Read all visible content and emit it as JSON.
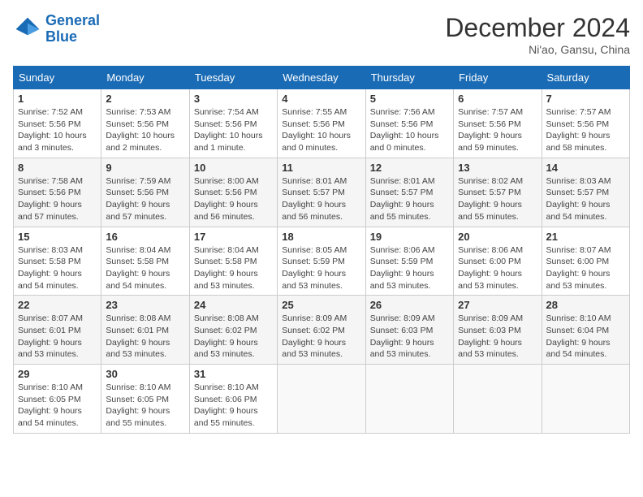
{
  "header": {
    "logo_line1": "General",
    "logo_line2": "Blue",
    "month_title": "December 2024",
    "location": "Ni'ao, Gansu, China"
  },
  "weekdays": [
    "Sunday",
    "Monday",
    "Tuesday",
    "Wednesday",
    "Thursday",
    "Friday",
    "Saturday"
  ],
  "weeks": [
    [
      {
        "day": "1",
        "sunrise": "7:52 AM",
        "sunset": "5:56 PM",
        "daylight": "10 hours and 3 minutes."
      },
      {
        "day": "2",
        "sunrise": "7:53 AM",
        "sunset": "5:56 PM",
        "daylight": "10 hours and 2 minutes."
      },
      {
        "day": "3",
        "sunrise": "7:54 AM",
        "sunset": "5:56 PM",
        "daylight": "10 hours and 1 minute."
      },
      {
        "day": "4",
        "sunrise": "7:55 AM",
        "sunset": "5:56 PM",
        "daylight": "10 hours and 0 minutes."
      },
      {
        "day": "5",
        "sunrise": "7:56 AM",
        "sunset": "5:56 PM",
        "daylight": "10 hours and 0 minutes."
      },
      {
        "day": "6",
        "sunrise": "7:57 AM",
        "sunset": "5:56 PM",
        "daylight": "9 hours and 59 minutes."
      },
      {
        "day": "7",
        "sunrise": "7:57 AM",
        "sunset": "5:56 PM",
        "daylight": "9 hours and 58 minutes."
      }
    ],
    [
      {
        "day": "8",
        "sunrise": "7:58 AM",
        "sunset": "5:56 PM",
        "daylight": "9 hours and 57 minutes."
      },
      {
        "day": "9",
        "sunrise": "7:59 AM",
        "sunset": "5:56 PM",
        "daylight": "9 hours and 57 minutes."
      },
      {
        "day": "10",
        "sunrise": "8:00 AM",
        "sunset": "5:56 PM",
        "daylight": "9 hours and 56 minutes."
      },
      {
        "day": "11",
        "sunrise": "8:01 AM",
        "sunset": "5:57 PM",
        "daylight": "9 hours and 56 minutes."
      },
      {
        "day": "12",
        "sunrise": "8:01 AM",
        "sunset": "5:57 PM",
        "daylight": "9 hours and 55 minutes."
      },
      {
        "day": "13",
        "sunrise": "8:02 AM",
        "sunset": "5:57 PM",
        "daylight": "9 hours and 55 minutes."
      },
      {
        "day": "14",
        "sunrise": "8:03 AM",
        "sunset": "5:57 PM",
        "daylight": "9 hours and 54 minutes."
      }
    ],
    [
      {
        "day": "15",
        "sunrise": "8:03 AM",
        "sunset": "5:58 PM",
        "daylight": "9 hours and 54 minutes."
      },
      {
        "day": "16",
        "sunrise": "8:04 AM",
        "sunset": "5:58 PM",
        "daylight": "9 hours and 54 minutes."
      },
      {
        "day": "17",
        "sunrise": "8:04 AM",
        "sunset": "5:58 PM",
        "daylight": "9 hours and 53 minutes."
      },
      {
        "day": "18",
        "sunrise": "8:05 AM",
        "sunset": "5:59 PM",
        "daylight": "9 hours and 53 minutes."
      },
      {
        "day": "19",
        "sunrise": "8:06 AM",
        "sunset": "5:59 PM",
        "daylight": "9 hours and 53 minutes."
      },
      {
        "day": "20",
        "sunrise": "8:06 AM",
        "sunset": "6:00 PM",
        "daylight": "9 hours and 53 minutes."
      },
      {
        "day": "21",
        "sunrise": "8:07 AM",
        "sunset": "6:00 PM",
        "daylight": "9 hours and 53 minutes."
      }
    ],
    [
      {
        "day": "22",
        "sunrise": "8:07 AM",
        "sunset": "6:01 PM",
        "daylight": "9 hours and 53 minutes."
      },
      {
        "day": "23",
        "sunrise": "8:08 AM",
        "sunset": "6:01 PM",
        "daylight": "9 hours and 53 minutes."
      },
      {
        "day": "24",
        "sunrise": "8:08 AM",
        "sunset": "6:02 PM",
        "daylight": "9 hours and 53 minutes."
      },
      {
        "day": "25",
        "sunrise": "8:09 AM",
        "sunset": "6:02 PM",
        "daylight": "9 hours and 53 minutes."
      },
      {
        "day": "26",
        "sunrise": "8:09 AM",
        "sunset": "6:03 PM",
        "daylight": "9 hours and 53 minutes."
      },
      {
        "day": "27",
        "sunrise": "8:09 AM",
        "sunset": "6:03 PM",
        "daylight": "9 hours and 53 minutes."
      },
      {
        "day": "28",
        "sunrise": "8:10 AM",
        "sunset": "6:04 PM",
        "daylight": "9 hours and 54 minutes."
      }
    ],
    [
      {
        "day": "29",
        "sunrise": "8:10 AM",
        "sunset": "6:05 PM",
        "daylight": "9 hours and 54 minutes."
      },
      {
        "day": "30",
        "sunrise": "8:10 AM",
        "sunset": "6:05 PM",
        "daylight": "9 hours and 55 minutes."
      },
      {
        "day": "31",
        "sunrise": "8:10 AM",
        "sunset": "6:06 PM",
        "daylight": "9 hours and 55 minutes."
      },
      null,
      null,
      null,
      null
    ]
  ]
}
